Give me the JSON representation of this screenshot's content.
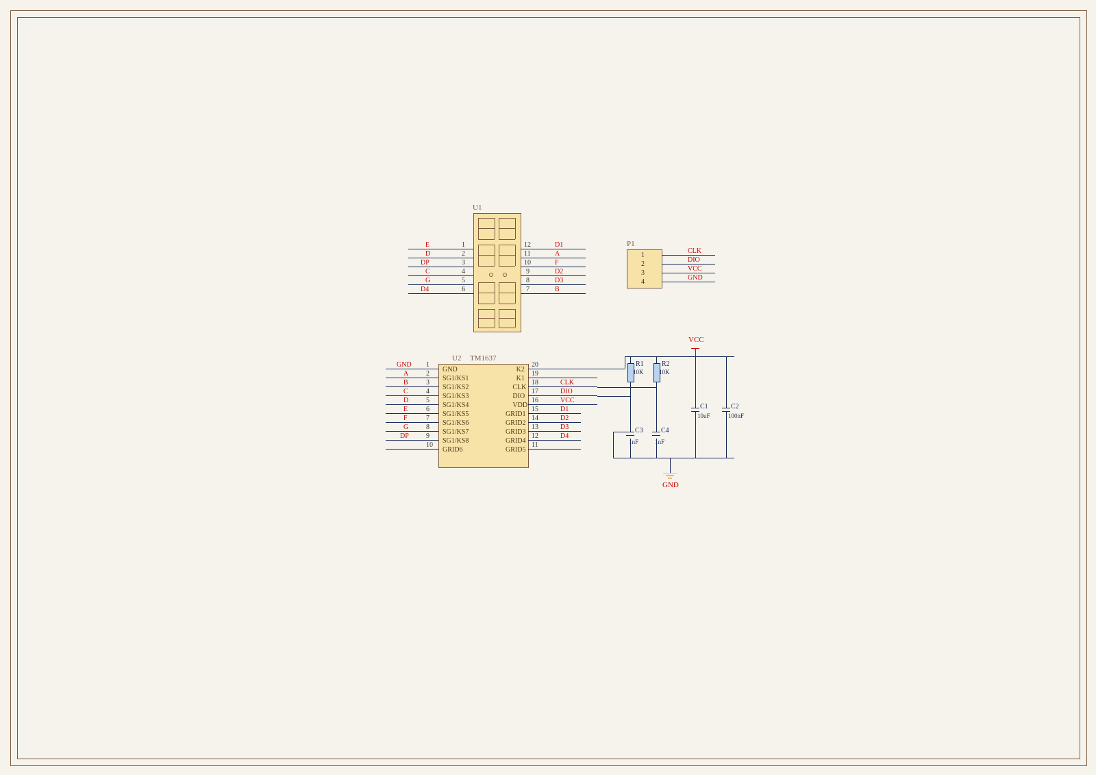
{
  "components": {
    "U1": {
      "designator": "U1",
      "type": "4-digit-7-segment-display",
      "left_pins": [
        {
          "num": "1",
          "net": "E"
        },
        {
          "num": "2",
          "net": "D"
        },
        {
          "num": "3",
          "net": "DP"
        },
        {
          "num": "4",
          "net": "C"
        },
        {
          "num": "5",
          "net": "G"
        },
        {
          "num": "6",
          "net": "D4"
        }
      ],
      "right_pins": [
        {
          "num": "12",
          "net": "D1"
        },
        {
          "num": "11",
          "net": "A"
        },
        {
          "num": "10",
          "net": "F"
        },
        {
          "num": "9",
          "net": "D2"
        },
        {
          "num": "8",
          "net": "D3"
        },
        {
          "num": "7",
          "net": "B"
        }
      ]
    },
    "U2": {
      "designator": "U2",
      "part": "TM1637",
      "left_pins": [
        {
          "num": "1",
          "name": "GND",
          "net": "GND"
        },
        {
          "num": "2",
          "name": "SG1/KS1",
          "net": "A"
        },
        {
          "num": "3",
          "name": "SG1/KS2",
          "net": "B"
        },
        {
          "num": "4",
          "name": "SG1/KS3",
          "net": "C"
        },
        {
          "num": "5",
          "name": "SG1/KS4",
          "net": "D"
        },
        {
          "num": "6",
          "name": "SG1/KS5",
          "net": "E"
        },
        {
          "num": "7",
          "name": "SG1/KS6",
          "net": "F"
        },
        {
          "num": "8",
          "name": "SG1/KS7",
          "net": "G"
        },
        {
          "num": "9",
          "name": "SG1/KS8",
          "net": "DP"
        },
        {
          "num": "10",
          "name": "GRID6",
          "net": ""
        }
      ],
      "right_pins": [
        {
          "num": "20",
          "name": "K2",
          "net": ""
        },
        {
          "num": "19",
          "name": "K1",
          "net": ""
        },
        {
          "num": "18",
          "name": "CLK",
          "net": "CLK"
        },
        {
          "num": "17",
          "name": "DIO",
          "net": "DIO"
        },
        {
          "num": "16",
          "name": "VDD",
          "net": "VCC"
        },
        {
          "num": "15",
          "name": "GRID1",
          "net": "D1"
        },
        {
          "num": "14",
          "name": "GRID2",
          "net": "D2"
        },
        {
          "num": "13",
          "name": "GRID3",
          "net": "D3"
        },
        {
          "num": "12",
          "name": "GRID4",
          "net": "D4"
        },
        {
          "num": "11",
          "name": "GRID5",
          "net": ""
        }
      ]
    },
    "P1": {
      "designator": "P1",
      "pins": [
        {
          "num": "1",
          "net": "CLK"
        },
        {
          "num": "2",
          "net": "DIO"
        },
        {
          "num": "3",
          "net": "VCC"
        },
        {
          "num": "4",
          "net": "GND"
        }
      ]
    },
    "R1": {
      "designator": "R1",
      "value": "10K"
    },
    "R2": {
      "designator": "R2",
      "value": "10K"
    },
    "C1": {
      "designator": "C1",
      "value": "10uF"
    },
    "C2": {
      "designator": "C2",
      "value": "100nF"
    },
    "C3": {
      "designator": "C3",
      "value": "1nF"
    },
    "C4": {
      "designator": "C4",
      "value": "1nF"
    }
  },
  "power": {
    "vcc": "VCC",
    "gnd": "GND"
  }
}
